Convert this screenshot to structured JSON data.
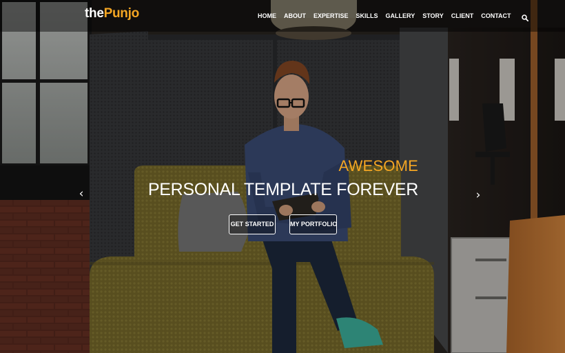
{
  "brand": {
    "prefix": "the",
    "accent": "Punjo",
    "accent_color": "#f5a623"
  },
  "nav": {
    "items": [
      "HOME",
      "ABOUT",
      "EXPERTISE",
      "SKILLS",
      "GALLERY",
      "STORY",
      "CLIENT",
      "CONTACT"
    ],
    "search_icon": "search-icon"
  },
  "slider": {
    "subtitle": "AWESOME",
    "title": "PERSONAL TEMPLATE FOREVER",
    "primary_button": "GET STARTED",
    "secondary_button": "MY PORTFOLIO",
    "prev_icon": "‹",
    "next_icon": "›"
  },
  "colors": {
    "accent": "#f5a623",
    "text": "#ffffff"
  }
}
